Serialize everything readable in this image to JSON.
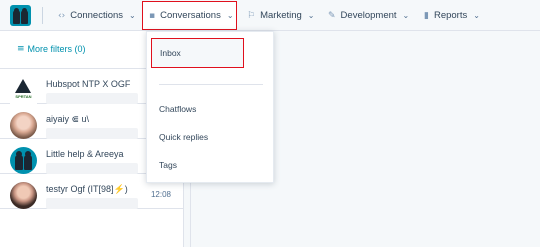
{
  "nav": {
    "connections": "Connections",
    "conversations": "Conversations",
    "marketing": "Marketing",
    "development": "Development",
    "reports": "Reports",
    "icons": {
      "connections": "arrows-icon",
      "conversations": "chat-icon",
      "marketing": "megaphone-icon",
      "development": "wrench-icon",
      "reports": "bar-chart-icon"
    }
  },
  "sidebar": {
    "filters_label": "More filters (0)",
    "conversations": [
      {
        "name": "Hubspot NTP X OGF",
        "time": ""
      },
      {
        "name": "aiyaiy ⋐ u\\",
        "time": ""
      },
      {
        "name": "Little help & Areeya",
        "time": ""
      },
      {
        "name": "testyr Ogf (IT[98]⚡)",
        "time": "12:08"
      }
    ]
  },
  "dropdown": {
    "items": [
      "Inbox",
      "Chatflows",
      "Quick replies",
      "Tags"
    ]
  },
  "colors": {
    "accent": "#0091ae",
    "highlight_border": "#e0101d",
    "text": "#33475b"
  }
}
